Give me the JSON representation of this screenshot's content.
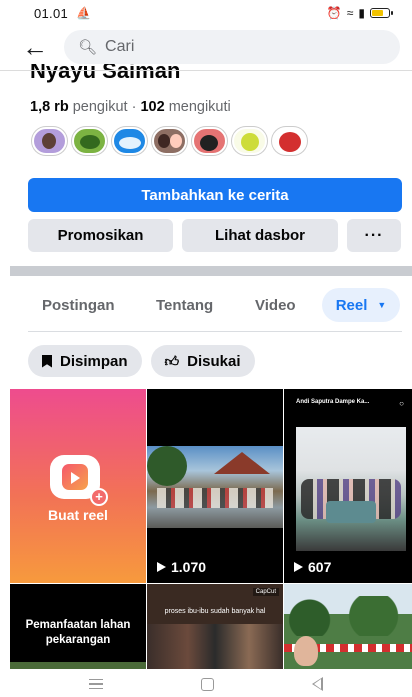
{
  "status_bar": {
    "time": "01.01",
    "time_icon": "boat-icon",
    "right_icons": [
      "alarm-icon",
      "wifi-icon",
      "signal-icon",
      "battery-icon"
    ],
    "battery_color": "#f2c300"
  },
  "search": {
    "placeholder": "Cari"
  },
  "profile": {
    "name": "Nyayu Saiman",
    "followers_count": "1,8 rb",
    "followers_label": "pengikut",
    "separator": "·",
    "following_count": "102",
    "following_label": "mengikuti"
  },
  "actions": {
    "add_story": "Tambahkan ke cerita",
    "promote": "Promosikan",
    "dashboard": "Lihat dasbor",
    "more": "···"
  },
  "tabs": [
    {
      "label": "Postingan"
    },
    {
      "label": "Tentang"
    },
    {
      "label": "Video"
    },
    {
      "label": "Reel",
      "active": true
    }
  ],
  "filters": {
    "saved": "Disimpan",
    "liked": "Disukai"
  },
  "reels": {
    "create_label": "Buat reel",
    "video1_views": "1.070",
    "video2_header": "Andi Saputra Dampe Ka...",
    "video2_views": "607",
    "bottom1_text": "Pemanfaatan lahan pekarangan",
    "bottom2_tag": "CapCut",
    "bottom2_text": "proses ibu-ibu sudah banyak hal"
  },
  "colors": {
    "primary": "#1877f2",
    "grey_button": "#e4e6eb",
    "active_tab_bg": "#e7f0fd"
  }
}
